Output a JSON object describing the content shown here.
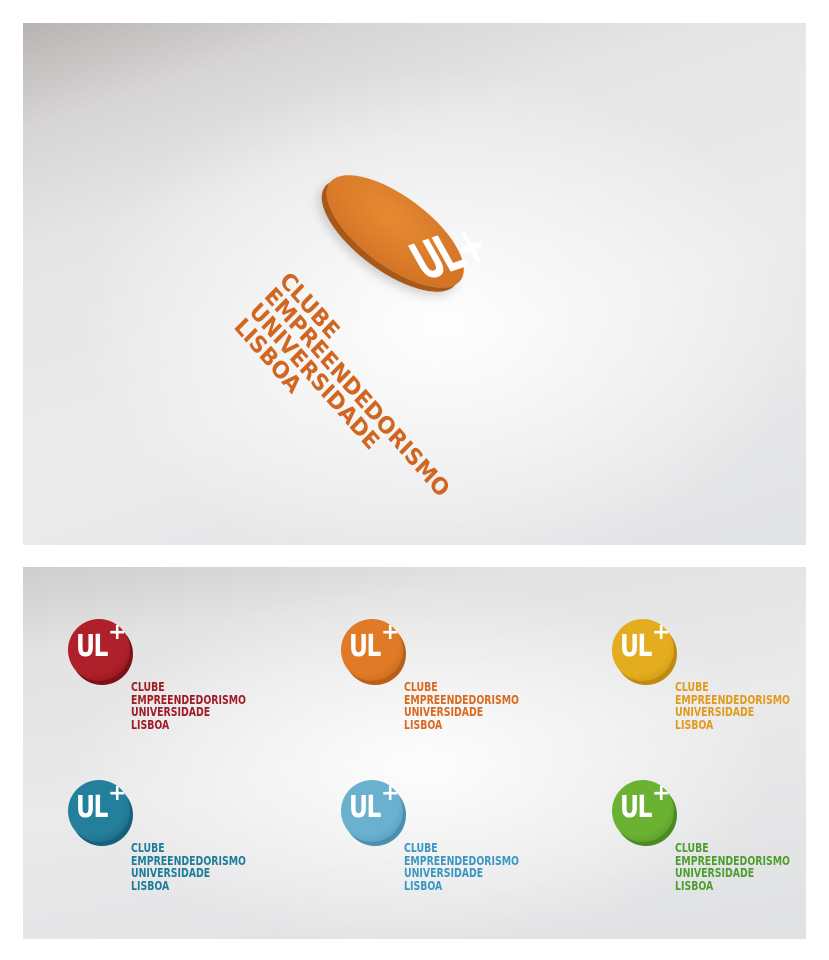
{
  "hero": {
    "logo_mark": "UL+",
    "lines": [
      "CLUBE",
      "EMPREENDEDORISMO",
      "UNIVERSIDADE",
      "LISBOA"
    ],
    "color": "#d0661f"
  },
  "variants": [
    {
      "mark_main": "UL",
      "mark_plus": "+",
      "lines": [
        "CLUBE",
        "EMPREENDEDORISMO",
        "UNIVERSIDADE",
        "LISBOA"
      ],
      "color": "#b0202a",
      "shadow": "#7d1119",
      "text_color": "#9e1c26"
    },
    {
      "mark_main": "UL",
      "mark_plus": "+",
      "lines": [
        "CLUBE",
        "EMPREENDEDORISMO",
        "UNIVERSIDADE",
        "LISBOA"
      ],
      "color": "#e07a27",
      "shadow": "#b95f17",
      "text_color": "#d8691f"
    },
    {
      "mark_main": "UL",
      "mark_plus": "+",
      "lines": [
        "CLUBE",
        "EMPREENDEDORISMO",
        "UNIVERSIDADE",
        "LISBOA"
      ],
      "color": "#e4ad1f",
      "shadow": "#bf8a10",
      "text_color": "#e09a1c"
    },
    {
      "mark_main": "UL",
      "mark_plus": "+",
      "lines": [
        "CLUBE",
        "EMPREENDEDORISMO",
        "UNIVERSIDADE",
        "LISBOA"
      ],
      "color": "#237f9b",
      "shadow": "#16607a",
      "text_color": "#1f7c99"
    },
    {
      "mark_main": "UL",
      "mark_plus": "+",
      "lines": [
        "CLUBE",
        "EMPREENDEDORISMO",
        "UNIVERSIDADE",
        "LISBOA"
      ],
      "color": "#6ab1cf",
      "shadow": "#4a8fae",
      "text_color": "#3a97c0"
    },
    {
      "mark_main": "UL",
      "mark_plus": "+",
      "lines": [
        "CLUBE",
        "EMPREENDEDORISMO",
        "UNIVERSIDADE",
        "LISBOA"
      ],
      "color": "#6bb233",
      "shadow": "#4c8b1f",
      "text_color": "#4c9e2d"
    }
  ]
}
